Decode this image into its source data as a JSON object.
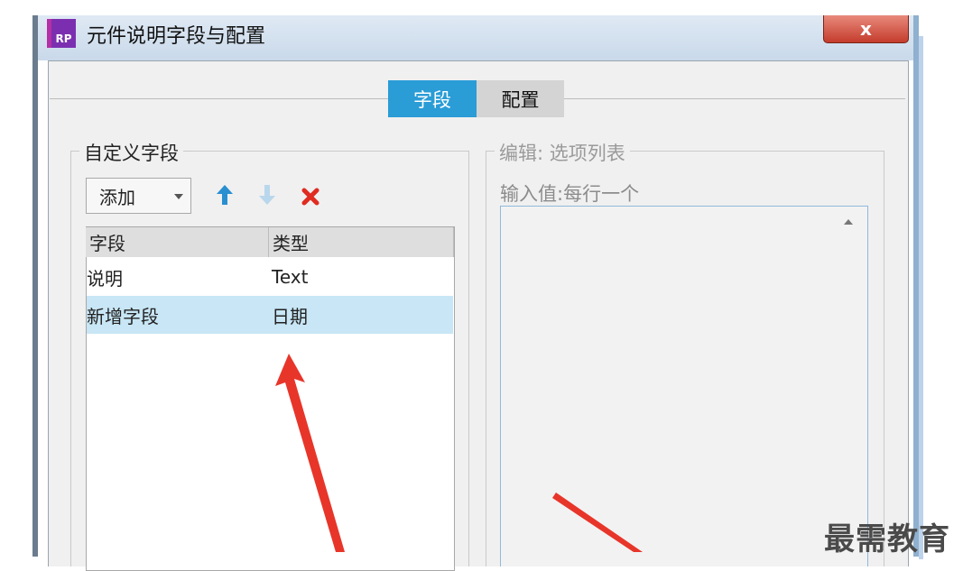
{
  "window": {
    "app_icon_text": "RP",
    "title": "元件说明字段与配置",
    "close_label": "x"
  },
  "tabs": [
    {
      "label": "字段",
      "active": true
    },
    {
      "label": "配置",
      "active": false
    }
  ],
  "left_panel": {
    "title": "自定义字段",
    "add_dropdown": "添加",
    "icons": [
      "arrow-up-icon",
      "arrow-down-icon",
      "delete-icon"
    ],
    "columns": [
      "字段",
      "类型"
    ],
    "rows": [
      {
        "field": "说明",
        "type": "Text",
        "selected": false
      },
      {
        "field": "新增字段",
        "type": "日期",
        "selected": true
      }
    ]
  },
  "right_panel": {
    "title": "编辑: 选项列表",
    "input_label": "输入值:每行一个",
    "textarea_value": ""
  },
  "colors": {
    "accent": "#2a9cd6",
    "selected_row": "#c8e6f5",
    "annotation_arrow": "#e8352a"
  },
  "watermark": "最需教育"
}
